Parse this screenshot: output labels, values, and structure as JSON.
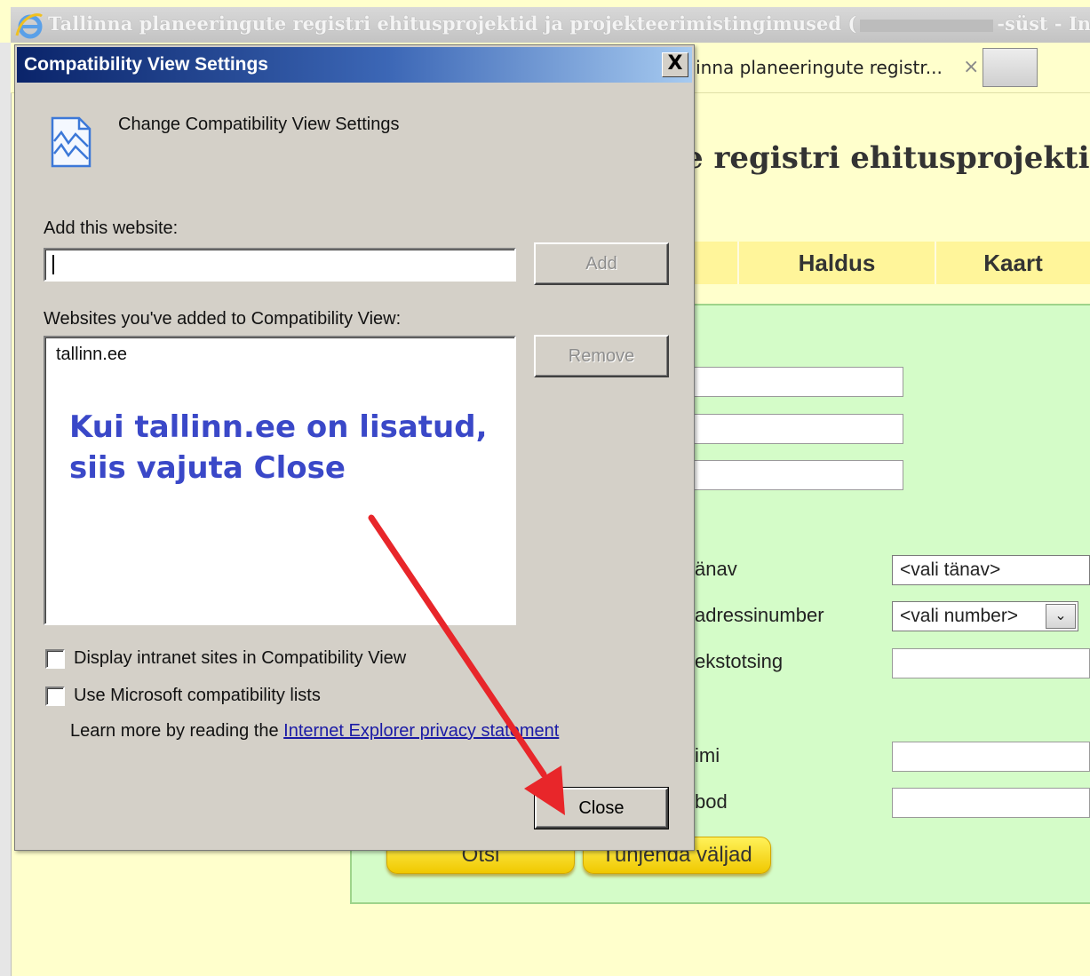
{
  "browser": {
    "title": "Tallinna planeeringute registri ehitusprojektid ja projekteerimistingimused (",
    "title_suffix": "-süst - Inte",
    "tab_label": "llinna planeeringute registr...",
    "tab_close": "×",
    "page_heading": "e registri ehitusprojektid",
    "nav": [
      "Haldus",
      "Kaart"
    ],
    "form_labels": [
      "änav",
      "adressinumber",
      "ekstotsing",
      "imi",
      "bod"
    ],
    "street_select": "<vali tänav>",
    "number_select": "<vali number>",
    "buttons": {
      "search": "Otsi",
      "clear": "Tühjenda väljad"
    }
  },
  "dialog": {
    "title": "Compatibility View Settings",
    "close_glyph": "X",
    "heading": "Change Compatibility View Settings",
    "add_label": "Add this website:",
    "add_input_value": "",
    "add_button": "Add",
    "list_label": "Websites you've added to Compatibility View:",
    "websites": [
      "tallinn.ee"
    ],
    "remove_button": "Remove",
    "checkbox_intranet": "Display intranet sites in Compatibility View",
    "checkbox_intranet_checked": false,
    "checkbox_ms_lists": "Use Microsoft compatibility lists",
    "checkbox_ms_lists_checked": false,
    "learn_more_prefix": "Learn more by reading the ",
    "privacy_link": "Internet Explorer privacy statement",
    "close_button": "Close"
  },
  "annotation": {
    "line1": "Kui tallinn.ee on lisatud,",
    "line2": "siis vajuta Close",
    "color": "#3a48c8",
    "arrow_color": "#e8262a"
  }
}
